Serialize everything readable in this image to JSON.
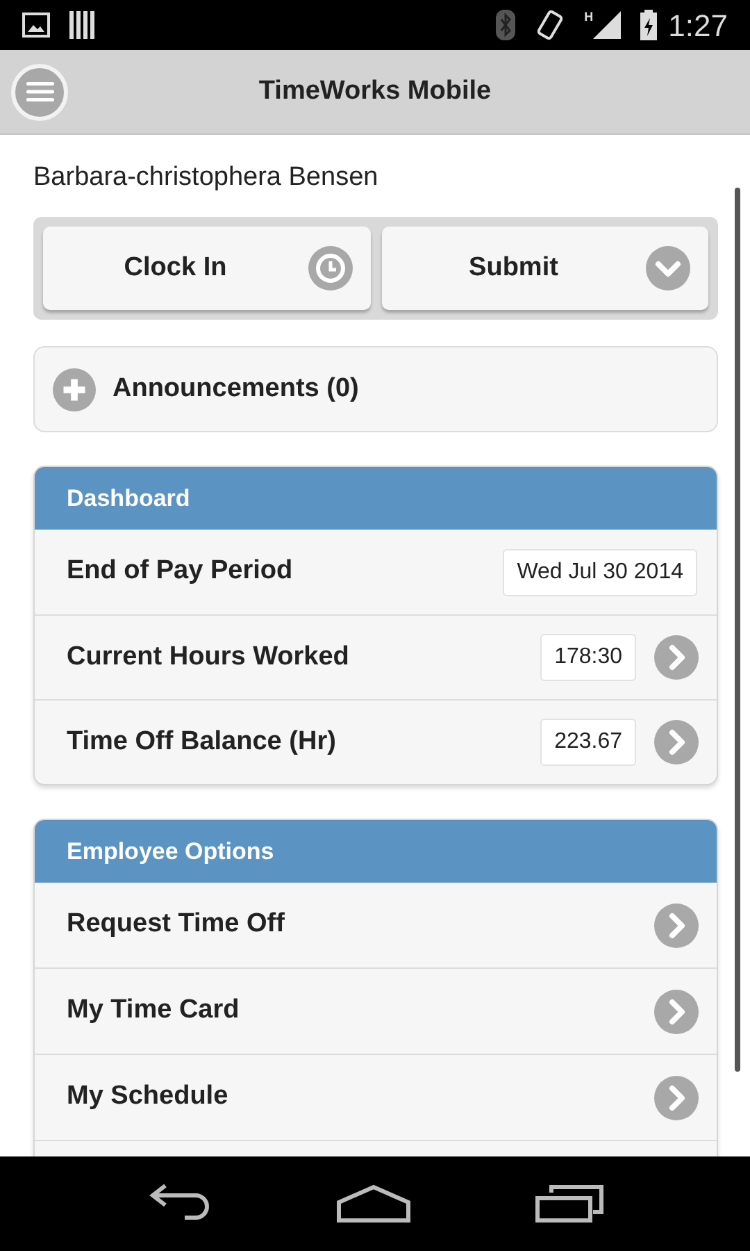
{
  "status_bar": {
    "network": "H",
    "time": "1:27"
  },
  "app_bar": {
    "title": "TimeWorks Mobile"
  },
  "user_name": "Barbara-christophera Bensen",
  "actions": [
    {
      "label": "Clock In",
      "kind": "clock"
    },
    {
      "label": "Submit",
      "kind": "dropdown"
    }
  ],
  "announcements": {
    "label": "Announcements (0)"
  },
  "dashboard": {
    "title": "Dashboard",
    "rows": [
      {
        "label": "End of Pay Period",
        "value": "Wed Jul 30 2014",
        "kind": "value"
      },
      {
        "label": "Current Hours Worked",
        "value": "178:30",
        "kind": "link"
      },
      {
        "label": "Time Off Balance (Hr)",
        "value": "223.67",
        "kind": "link"
      }
    ]
  },
  "employee_options": {
    "title": "Employee Options",
    "items": [
      {
        "label": "Request Time Off"
      },
      {
        "label": "My Time Card"
      },
      {
        "label": "My Schedule"
      }
    ]
  }
}
